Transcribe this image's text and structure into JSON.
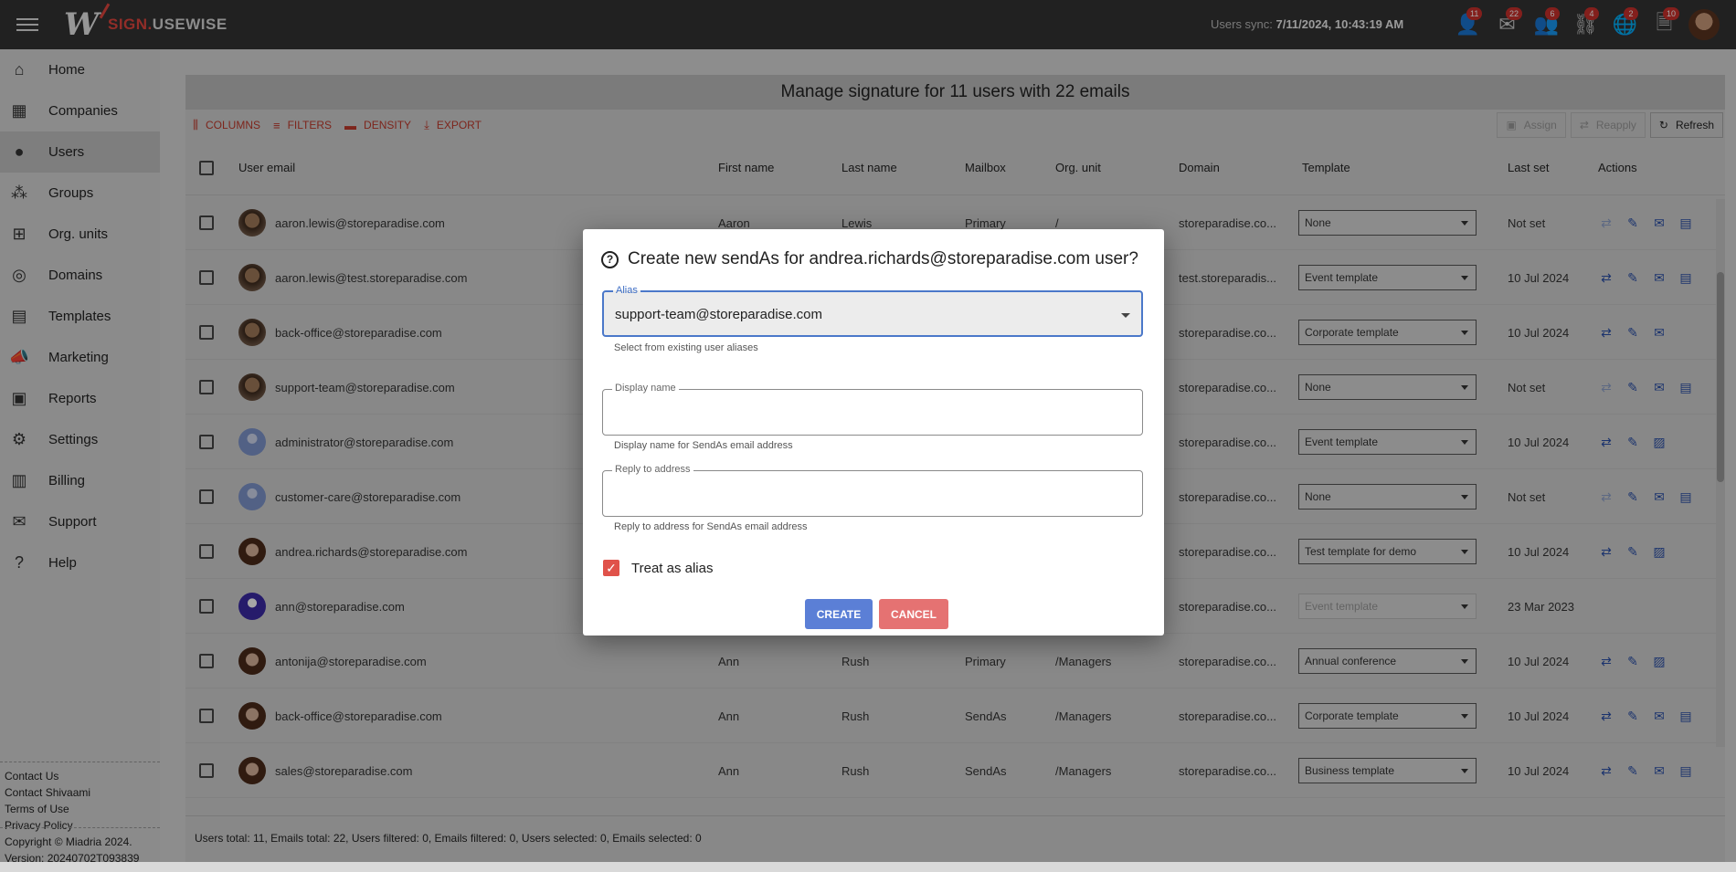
{
  "app": {
    "logo_prefix": "SIGN.",
    "logo_suffix": "USEWISE",
    "sync_label": "Users sync:",
    "sync_value": "7/11/2024, 10:43:19 AM"
  },
  "top_icons": [
    {
      "icon": "user-icon",
      "glyph": "👤",
      "badge": "11"
    },
    {
      "icon": "mail-icon",
      "glyph": "✉",
      "badge": "22"
    },
    {
      "icon": "group-icon",
      "glyph": "👥",
      "badge": "6"
    },
    {
      "icon": "org-tree-icon",
      "glyph": "⛓",
      "badge": "4"
    },
    {
      "icon": "globe-icon",
      "glyph": "🌐",
      "badge": "2"
    },
    {
      "icon": "template-icon",
      "glyph": "🗎",
      "badge": "10"
    }
  ],
  "sidebar": {
    "items": [
      {
        "label": "Home",
        "glyph": "⌂",
        "icon": "home-icon"
      },
      {
        "label": "Companies",
        "glyph": "▦",
        "icon": "company-icon"
      },
      {
        "label": "Users",
        "glyph": "●",
        "icon": "user-icon"
      },
      {
        "label": "Groups",
        "glyph": "⁂",
        "icon": "groups-icon"
      },
      {
        "label": "Org. units",
        "glyph": "⊞",
        "icon": "org-units-icon"
      },
      {
        "label": "Domains",
        "glyph": "◎",
        "icon": "globe-icon"
      },
      {
        "label": "Templates",
        "glyph": "▤",
        "icon": "template-icon"
      },
      {
        "label": "Marketing",
        "glyph": "📣",
        "icon": "megaphone-icon"
      },
      {
        "label": "Reports",
        "glyph": "▣",
        "icon": "report-icon"
      },
      {
        "label": "Settings",
        "glyph": "⚙",
        "icon": "gear-icon"
      },
      {
        "label": "Billing",
        "glyph": "▥",
        "icon": "billing-icon"
      },
      {
        "label": "Support",
        "glyph": "✉",
        "icon": "mail-icon"
      },
      {
        "label": "Help",
        "glyph": "?",
        "icon": "help-icon"
      }
    ],
    "active_index": 2,
    "footer_links": [
      "Contact Us",
      "Contact Shivaami",
      "Terms of Use",
      "Privacy Policy"
    ],
    "copyright": "Copyright © Miadria 2024.",
    "version": "Version: 20240702T093839"
  },
  "main": {
    "title": "Manage signature for 11 users with 22 emails",
    "toolbar": {
      "columns": "COLUMNS",
      "filters": "FILTERS",
      "density": "DENSITY",
      "export": "EXPORT",
      "assign": "Assign",
      "reapply": "Reapply",
      "refresh": "Refresh"
    },
    "columns": [
      "User email",
      "First name",
      "Last name",
      "Mailbox",
      "Org. unit",
      "Domain",
      "Template",
      "Last set",
      "Actions"
    ],
    "rows": [
      {
        "email": "aaron.lewis@storeparadise.com",
        "first": "Aaron",
        "last": "Lewis",
        "mailbox": "Primary",
        "org": "/",
        "domain": "storeparadise.co...",
        "template": "None",
        "last_set": "Not set",
        "avatar": "man"
      },
      {
        "email": "aaron.lewis@test.storeparadise.com",
        "first": "",
        "last": "",
        "mailbox": "",
        "org": "",
        "domain": "test.storeparadis...",
        "template": "Event template",
        "last_set": "10 Jul 2024",
        "avatar": "man"
      },
      {
        "email": "back-office@storeparadise.com",
        "first": "",
        "last": "",
        "mailbox": "",
        "org": "",
        "domain": "storeparadise.co...",
        "template": "Corporate template",
        "last_set": "10 Jul 2024",
        "avatar": "man"
      },
      {
        "email": "support-team@storeparadise.com",
        "first": "",
        "last": "",
        "mailbox": "",
        "org": "",
        "domain": "storeparadise.co...",
        "template": "None",
        "last_set": "Not set",
        "avatar": "man"
      },
      {
        "email": "administrator@storeparadise.com",
        "first": "",
        "last": "",
        "mailbox": "",
        "org": "",
        "domain": "storeparadise.co...",
        "template": "Event template",
        "last_set": "10 Jul 2024",
        "avatar": "gen"
      },
      {
        "email": "customer-care@storeparadise.com",
        "first": "",
        "last": "",
        "mailbox": "",
        "org": "",
        "domain": "storeparadise.co...",
        "template": "None",
        "last_set": "Not set",
        "avatar": "gen"
      },
      {
        "email": "andrea.richards@storeparadise.com",
        "first": "",
        "last": "",
        "mailbox": "",
        "org": "",
        "domain": "storeparadise.co...",
        "template": "Test template for demo",
        "last_set": "10 Jul 2024",
        "avatar": "woman"
      },
      {
        "email": "ann@storeparadise.com",
        "first": "",
        "last": "",
        "mailbox": "",
        "org": "",
        "domain": "storeparadise.co...",
        "template": "Event template",
        "last_set": "23 Mar 2023",
        "avatar": "purple"
      },
      {
        "email": "antonija@storeparadise.com",
        "first": "Ann",
        "last": "Rush",
        "mailbox": "Primary",
        "org": "/Managers",
        "domain": "storeparadise.co...",
        "template": "Annual conference",
        "last_set": "10 Jul 2024",
        "avatar": "woman"
      },
      {
        "email": "back-office@storeparadise.com",
        "first": "Ann",
        "last": "Rush",
        "mailbox": "SendAs",
        "org": "/Managers",
        "domain": "storeparadise.co...",
        "template": "Corporate template",
        "last_set": "10 Jul 2024",
        "avatar": "woman"
      },
      {
        "email": "sales@storeparadise.com",
        "first": "Ann",
        "last": "Rush",
        "mailbox": "SendAs",
        "org": "/Managers",
        "domain": "storeparadise.co...",
        "template": "Business template",
        "last_set": "10 Jul 2024",
        "avatar": "woman"
      }
    ],
    "status": "Users total: 11, Emails total: 22, Users filtered: 0, Emails filtered: 0, Users selected: 0, Emails selected: 0"
  },
  "dialog": {
    "title": "Create new sendAs for andrea.richards@storeparadise.com user?",
    "alias_label": "Alias",
    "alias_value": "support-team@storeparadise.com",
    "alias_helper": "Select from existing user aliases",
    "display_label": "Display name",
    "display_value": "",
    "display_helper": "Display name for SendAs email address",
    "reply_label": "Reply to address",
    "reply_value": "",
    "reply_helper": "Reply to address for SendAs email address",
    "treat_alias": "Treat as alias",
    "create": "CREATE",
    "cancel": "CANCEL"
  }
}
